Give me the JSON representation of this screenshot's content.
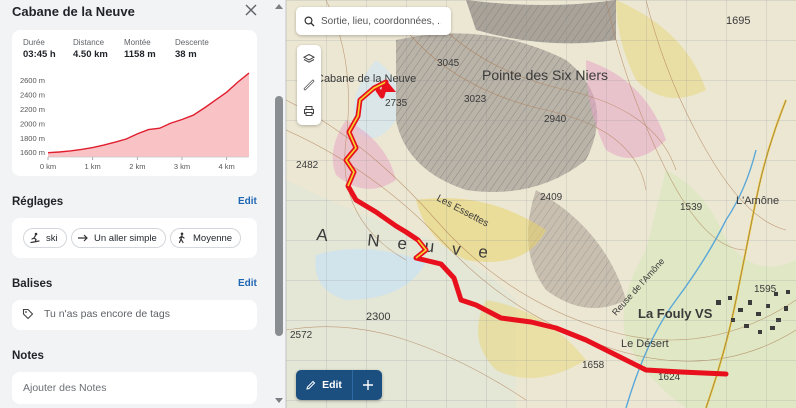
{
  "panel": {
    "title": "Cabane de la Neuve",
    "stats": [
      {
        "label": "Durée",
        "value": "03:45 h"
      },
      {
        "label": "Distance",
        "value": "4.50 km"
      },
      {
        "label": "Montée",
        "value": "1158 m"
      },
      {
        "label": "Descente",
        "value": "38 m"
      }
    ],
    "settings": {
      "title": "Réglages",
      "edit": "Edit",
      "chips": [
        {
          "icon": "ski-icon",
          "label": "ski"
        },
        {
          "icon": "arrow-right-icon",
          "label": "Un aller simple"
        },
        {
          "icon": "hiker-icon",
          "label": "Moyenne"
        }
      ]
    },
    "tags": {
      "title": "Balises",
      "edit": "Edit",
      "empty": "Tu n'as pas encore de tags"
    },
    "notes": {
      "title": "Notes",
      "placeholder": "Ajouter des Notes"
    }
  },
  "chart_data": {
    "type": "area",
    "title": "",
    "xlabel": "",
    "ylabel": "",
    "x": [
      0,
      0.25,
      0.5,
      0.75,
      1.0,
      1.25,
      1.5,
      1.75,
      2.0,
      2.25,
      2.5,
      2.75,
      3.0,
      3.25,
      3.5,
      3.75,
      4.0,
      4.25,
      4.5
    ],
    "series": [
      {
        "values": [
          1600,
          1610,
          1625,
          1645,
          1670,
          1705,
          1745,
          1790,
          1860,
          1920,
          1940,
          2010,
          2060,
          2120,
          2220,
          2330,
          2440,
          2580,
          2705
        ]
      }
    ],
    "x_ticks": [
      "0 km",
      "1 km",
      "2 km",
      "3 km",
      "4 km"
    ],
    "y_ticks": [
      "1600 m",
      "1800 m",
      "2000 m",
      "2200 m",
      "2400 m",
      "2600 m"
    ],
    "xlim": [
      0,
      4.5
    ],
    "ylim": [
      1540,
      2720
    ],
    "grid": false,
    "colors": {
      "line": "#e01e2e",
      "fill": "#f9c3c6"
    }
  },
  "map": {
    "search_placeholder": "Sortie, lieu, coordonnées, ...",
    "tools": [
      "layers-icon",
      "ruler-icon",
      "printer-icon"
    ],
    "edit_label": "Edit",
    "add_label": "+",
    "labels": [
      {
        "text": "Cabane de la Neuve",
        "kind": "hut"
      },
      {
        "text": "Pointe des Six Niers",
        "kind": "peak"
      },
      {
        "text": "La Fouly VS",
        "kind": "town"
      },
      {
        "text": "L'Amône",
        "kind": "place"
      },
      {
        "text": "Le Désert",
        "kind": "place"
      },
      {
        "text": "Reuse de l'Amône",
        "kind": "river"
      },
      {
        "text": "Les Essettes",
        "kind": "place"
      },
      {
        "text": "A Neuve",
        "kind": "region"
      }
    ],
    "elevations": [
      "1695",
      "3045",
      "2735",
      "3023",
      "2940",
      "2482",
      "2409",
      "1539",
      "1595",
      "2300",
      "2572",
      "1658",
      "1624"
    ],
    "route_color": "#e8101c"
  }
}
